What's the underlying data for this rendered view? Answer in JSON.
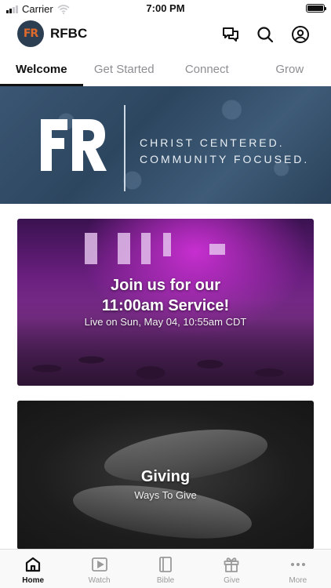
{
  "status_bar": {
    "carrier": "Carrier",
    "time": "7:00 PM"
  },
  "header": {
    "logo_text": "FR",
    "title": "RFBC",
    "icons": [
      "chat-icon",
      "search-icon",
      "account-icon"
    ]
  },
  "tabs": [
    {
      "label": "Welcome",
      "active": true
    },
    {
      "label": "Get Started",
      "active": false
    },
    {
      "label": "Connect",
      "active": false
    },
    {
      "label": "Grow",
      "active": false
    }
  ],
  "hero": {
    "mark_text": "FR",
    "line1": "CHRIST CENTERED.",
    "line2": "COMMUNITY FOCUSED."
  },
  "cards": {
    "service": {
      "title_line1": "Join us for our",
      "title_line2": "11:00am Service!",
      "subtitle": "Live on Sun, May 04, 10:55am CDT"
    },
    "giving": {
      "title": "Giving",
      "subtitle": "Ways To Give"
    }
  },
  "bottom_nav": [
    {
      "label": "Home",
      "icon": "home-icon",
      "active": true
    },
    {
      "label": "Watch",
      "icon": "play-icon",
      "active": false
    },
    {
      "label": "Bible",
      "icon": "book-icon",
      "active": false
    },
    {
      "label": "Give",
      "icon": "gift-icon",
      "active": false
    },
    {
      "label": "More",
      "icon": "more-icon",
      "active": false
    }
  ],
  "colors": {
    "brand_navy": "#2c3e52",
    "brand_orange": "#e06a2c",
    "hero_blue": "#3a5672",
    "active_text": "#111111",
    "inactive_text": "#8e8e93"
  }
}
